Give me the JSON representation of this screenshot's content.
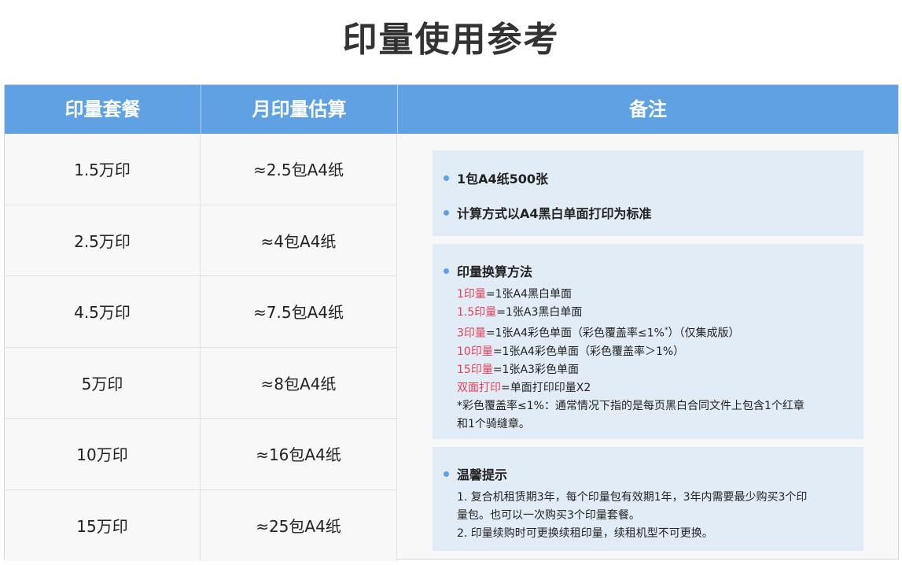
{
  "title": "印量使用参考",
  "headers": [
    "印量套餐",
    "月印量估算",
    "备注"
  ],
  "rows": [
    {
      "plan": "1.5万印",
      "estimate": "≈2.5包A4纸"
    },
    {
      "plan": "2.5万印",
      "estimate": "≈4包A4纸"
    },
    {
      "plan": "4.5万印",
      "estimate": "≈7.5包A4纸"
    },
    {
      "plan": "5万印",
      "estimate": "≈8包A4纸"
    },
    {
      "plan": "10万印",
      "estimate": "≈16包A4纸"
    },
    {
      "plan": "15万印",
      "estimate": "≈25包A4纸"
    }
  ],
  "notes": {
    "box1": {
      "bullet1": "1包A4纸500张",
      "bullet2": "计算方式以A4黑白单面打印为标准"
    },
    "box2": {
      "heading": "印量换算方法",
      "lines": [
        {
          "key": "1印量",
          "rest": "=1张A4黑白单面"
        },
        {
          "key": "1.5印量",
          "rest": "=1张A3黑白单面"
        },
        {
          "key": "3印量",
          "rest": "=1张A4彩色单面（彩色覆盖率≤1%",
          "sup": "*",
          "tail": "）（仅集成版）"
        },
        {
          "key": "10印量",
          "rest": "=1张A4彩色单面（彩色覆盖率＞1%）"
        },
        {
          "key": "15印量",
          "rest": "=1张A3彩色单面"
        },
        {
          "key": "双面打印",
          "rest": "=单面打印印量X2"
        }
      ],
      "footnote1": "*彩色覆盖率≤1%：通常情况下指的是每页黑白合同文件上包含1个红章",
      "footnote2": "和1个骑缝章。"
    },
    "box3": {
      "heading": "温馨提示",
      "line1": "1. 复合机租赁期3年，每个印量包有效期1年，3年内需要最少购买3个印",
      "line2": "量包。也可以一次购买3个印量套餐。",
      "line3": "2. 印量续购时可更换续租印量，续租机型不可更换。"
    }
  },
  "colors": {
    "header_bg": "#5fa1e3",
    "note_bg": "#e2ecf6",
    "highlight": "#e0405a"
  }
}
